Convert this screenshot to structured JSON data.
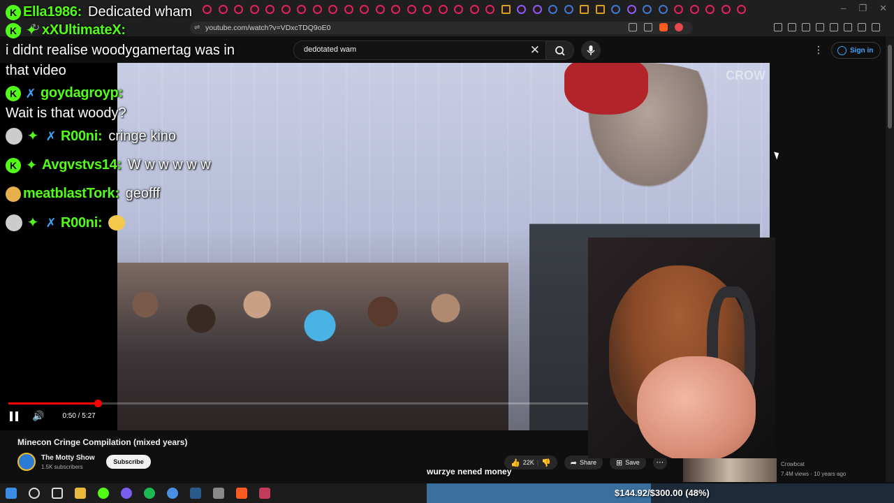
{
  "browser": {
    "url": "youtube.com/watch?v=VDxcTDQ9oE0"
  },
  "search": {
    "query": "dedotated wam"
  },
  "header": {
    "signin_label": "Sign in"
  },
  "video": {
    "watermark": "CROW",
    "time_display": "0:50 / 5:27",
    "progress_fraction": 0.154,
    "title": "Minecon Cringe Compilation (mixed years)"
  },
  "channel": {
    "name": "The Motty Show",
    "subscribers": "1.5K subscribers",
    "subscribe_label": "Subscribe"
  },
  "actions": {
    "like_count": "22K",
    "share_label": "Share",
    "save_label": "Save"
  },
  "suggestion": {
    "channel": "Crowbcat",
    "meta": "7.4M views · 10 years ago"
  },
  "chat": [
    {
      "user": "Ella1986:",
      "message": "Dedicated wham",
      "badges": [
        "kick"
      ],
      "layout": "inline"
    },
    {
      "user": "xXUltimateX:",
      "message": "i didnt realise woodygamertag was in that video",
      "badges": [
        "kick",
        "sub"
      ],
      "layout": "block"
    },
    {
      "user": "goydagroyp:",
      "message": "Wait is that woody?",
      "badges": [
        "kick",
        "sword"
      ],
      "layout": "block"
    },
    {
      "user": "R00ni:",
      "message": "cringe kino",
      "badges": [
        "avatar",
        "sub",
        "sword"
      ],
      "layout": "inline"
    },
    {
      "user": "Avgvstvs14:",
      "message": "W w w w w w",
      "badges": [
        "kick",
        "sub"
      ],
      "layout": "inline"
    },
    {
      "user": "meatblastTork:",
      "message": "geofff",
      "badges": [
        "face"
      ],
      "layout": "inline"
    },
    {
      "user": "R00ni:",
      "message": "",
      "badges": [
        "avatar",
        "sub",
        "sword"
      ],
      "layout": "emote"
    }
  ],
  "caption": {
    "text": "wurzye nened money"
  },
  "donation": {
    "text": "$144.92/$300.00 (48%)",
    "fraction": 0.48
  },
  "colors": {
    "kick_green": "#53fc18",
    "youtube_red": "#ff0000",
    "link_blue": "#3ea6ff"
  }
}
